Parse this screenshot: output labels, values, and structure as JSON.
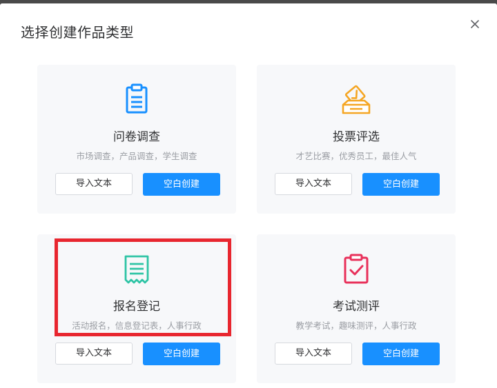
{
  "dialog": {
    "title": "选择创建作品类型"
  },
  "cards": [
    {
      "name": "问卷调查",
      "description": "市场调查，产品调查，学生调查",
      "icon": "clipboard-list-icon",
      "icon_color": "#1890ff",
      "import_label": "导入文本",
      "create_label": "空白创建"
    },
    {
      "name": "投票评选",
      "description": "才艺比赛，优秀员工，最佳人气",
      "icon": "ballot-box-icon",
      "icon_color": "#f5a623",
      "import_label": "导入文本",
      "create_label": "空白创建"
    },
    {
      "name": "报名登记",
      "description": "活动报名，信息登记表，人事行政",
      "icon": "receipt-icon",
      "icon_color": "#2ec4a5",
      "import_label": "导入文本",
      "create_label": "空白创建"
    },
    {
      "name": "考试测评",
      "description": "教学考试，趣味测评，人事行政",
      "icon": "clipboard-check-icon",
      "icon_color": "#e8305a",
      "import_label": "导入文本",
      "create_label": "空白创建"
    }
  ],
  "colors": {
    "primary": "#1890ff",
    "highlight": "#e8262f",
    "card_bg": "#f7f8fa"
  }
}
